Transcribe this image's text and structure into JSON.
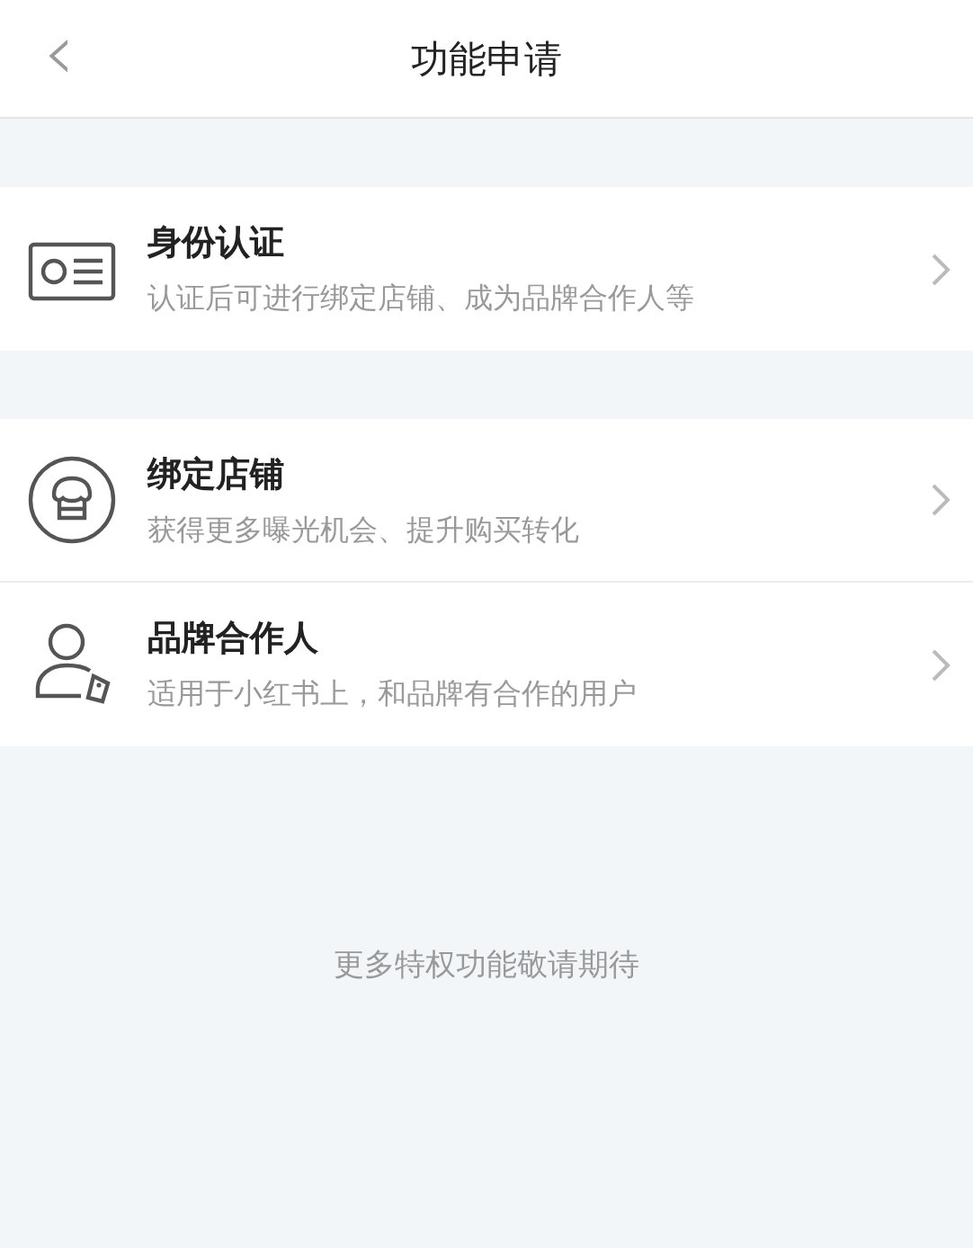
{
  "header": {
    "back_icon": "‹",
    "title": "功能申请"
  },
  "groups": [
    {
      "items": [
        {
          "kind": "id-card",
          "title": "身份认证",
          "subtitle": "认证后可进行绑定店铺、成为品牌合作人等"
        }
      ]
    },
    {
      "items": [
        {
          "kind": "shop",
          "title": "绑定店铺",
          "subtitle": "获得更多曝光机会、提升购买转化"
        },
        {
          "kind": "person-tag",
          "title": "品牌合作人",
          "subtitle": "适用于小红书上，和品牌有合作的用户"
        }
      ]
    }
  ],
  "footer_note": "更多特权功能敬请期待"
}
